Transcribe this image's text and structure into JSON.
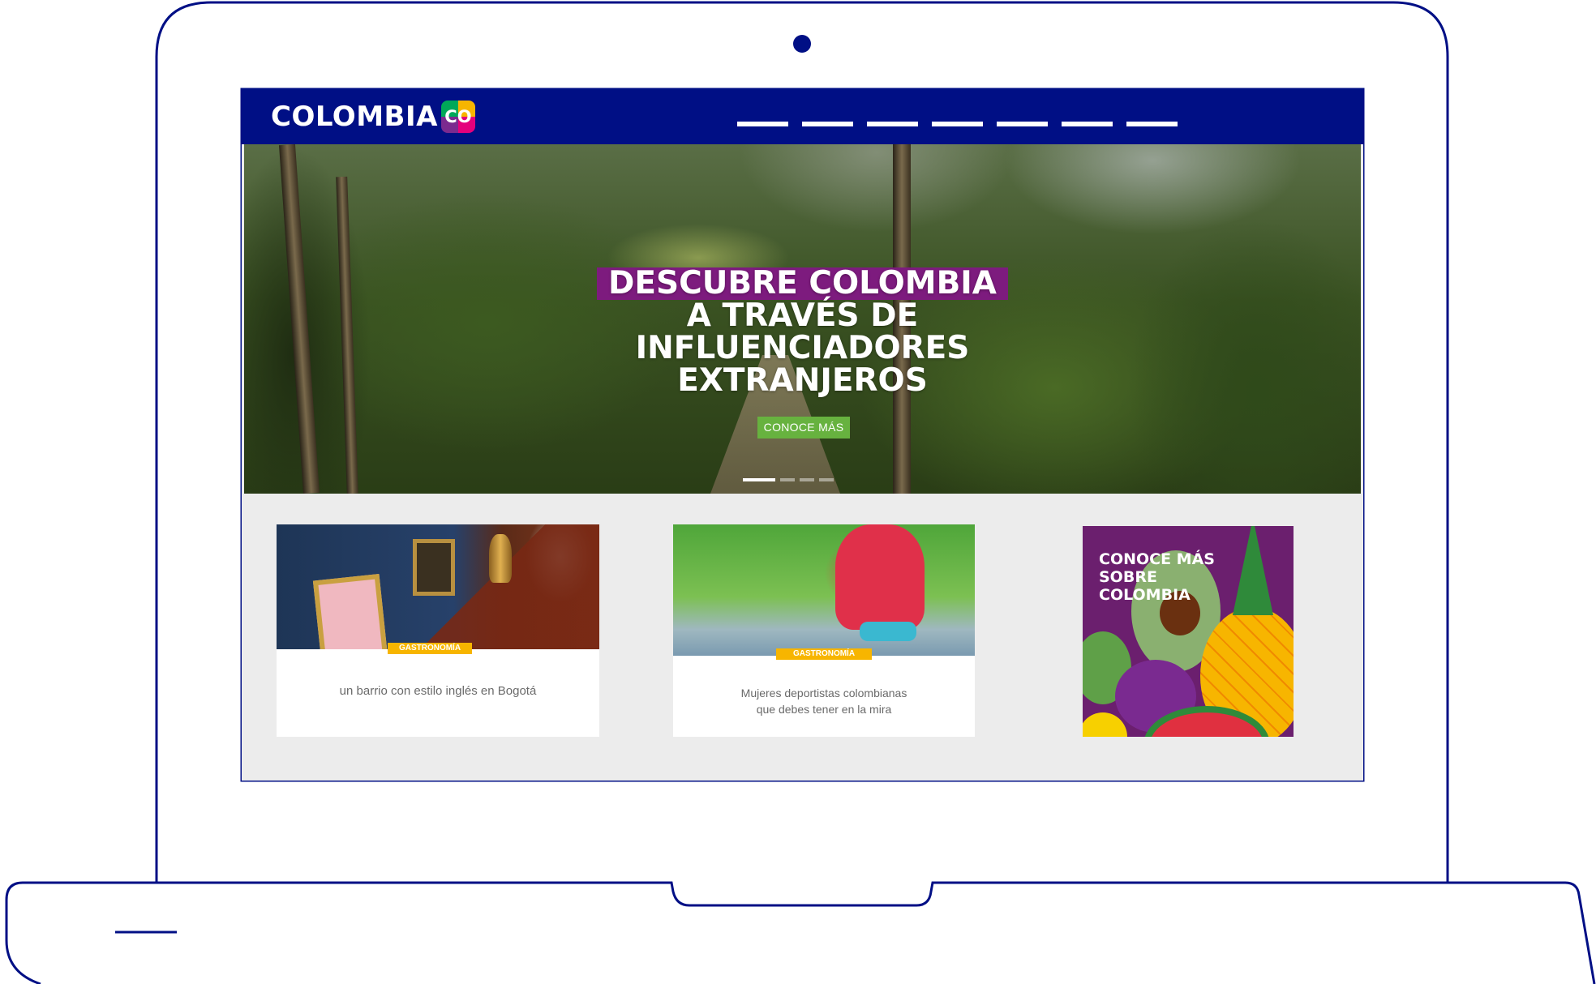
{
  "site": {
    "logo_text": "COLOMBIA",
    "logo_badge": "CO",
    "nav_items": [
      "",
      "",
      "",
      "",
      "",
      "",
      ""
    ]
  },
  "hero": {
    "title_line1": "DESCUBRE COLOMBIA",
    "title_line2": "A TRAVÉS DE",
    "title_line3": "INFLUENCIADORES",
    "title_line4": "EXTRANJEROS",
    "cta_label": "CONOCE MÁS",
    "slide_count": 4,
    "active_slide": 1
  },
  "cards": [
    {
      "tag": "GASTRONOMÍA",
      "text_line1": "un barrio con estilo inglés en Bogotá",
      "text_line2": ""
    },
    {
      "tag": "GASTRONOMÍA",
      "text_line1": "Mujeres deportistas colombianas",
      "text_line2": "que debes tener en la mira"
    }
  ],
  "promo": {
    "line1": "CONOCE MÁS",
    "line2": "SOBRE",
    "line3": "COLOMBIA"
  },
  "colors": {
    "brand_blue": "#000f85",
    "highlight_purple": "#7d1b7e",
    "cta_green": "#67b23f",
    "tag_yellow": "#f7b500",
    "page_gray": "#ececec"
  }
}
